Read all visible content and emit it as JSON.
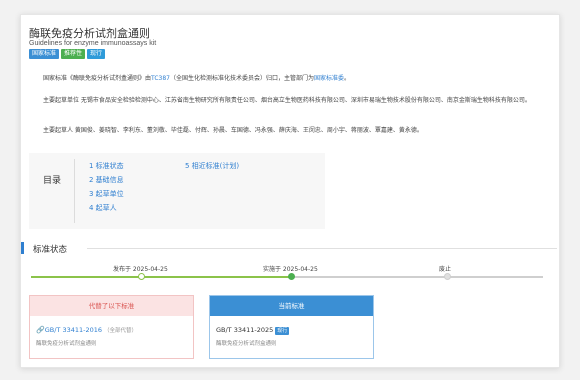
{
  "header": {
    "title_cn": "酶联免疫分析试剂盒通则",
    "title_en": "Guidelines for enzyme immunoassays kit",
    "badges": [
      "国家标准",
      "推荐性",
      "现行"
    ]
  },
  "intro": {
    "line1_prefix": "国家标准《酶联免疫分析试剂盒通则》由",
    "line1_link1": "TC387",
    "line1_mid": "（全国生化检测标准化技术委员会）归口，主管部门为",
    "line1_link2": "国家标准委",
    "line1_suffix": "。",
    "drafting_units": "主要起草单位 无锡市食品安全检验检测中心、江苏省南生物研究所有限责任公司、烟台高立生物医药科技有限公司、深圳市易瑞生物技术股份有限公司、南京金斯瑞生物科技有限公司。",
    "drafters": "主要起草人 黄国俊、姜晓智、李利东、董刘敬、毕佳磊、付辉、孙晨、车国德、冯永强、薛庆海、王闵忠、周小宇、蒋丽波、覃嘉建、黄永德。"
  },
  "toc": {
    "title": "目录",
    "items": [
      "1 标准状态",
      "2 基础信息",
      "3 起草单位",
      "4 起草人",
      "5 相近标准(计划)"
    ]
  },
  "status": {
    "title": "标准状态",
    "timeline": [
      {
        "label": "发布于 2025-04-25",
        "state": "done"
      },
      {
        "label": "实施于 2025-04-25",
        "state": "current"
      },
      {
        "label": "废止",
        "state": "pending"
      }
    ]
  },
  "panels": {
    "replaced": {
      "header": "代替了以下标准",
      "code": "GB/T 33411-2016",
      "note": "（全部代替）",
      "name": "酶联免疫分析试剂盒通则"
    },
    "current": {
      "header": "当前标准",
      "code": "GB/T 33411-2025",
      "badge": "现行",
      "name": "酶联免疫分析试剂盒通则"
    }
  },
  "colors": {
    "link": "#2f7fd0",
    "accent_blue": "#3b8fd4",
    "green": "#4caf50",
    "red": "#d9534f"
  }
}
